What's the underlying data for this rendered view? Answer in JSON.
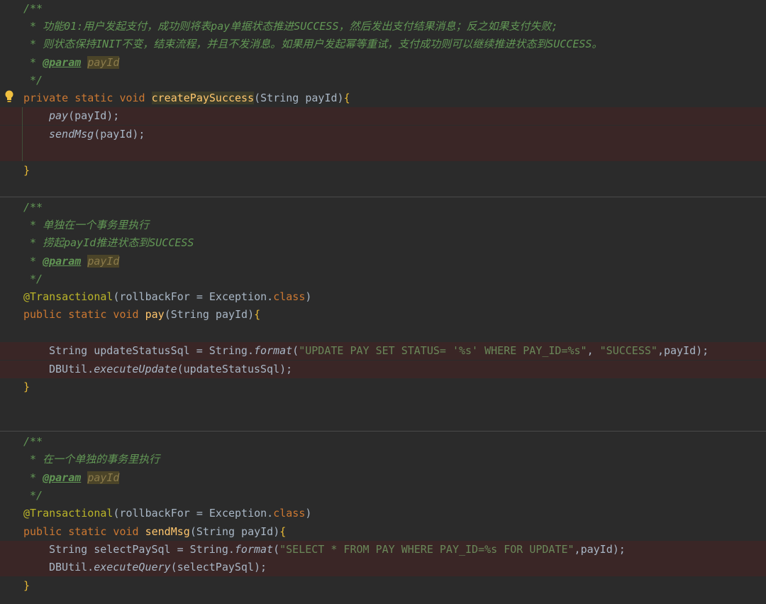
{
  "blocks": [
    {
      "comment": {
        "open": "/**",
        "lines": [
          " * 功能01:用户发起支付，成功则将表pay单据状态推进SUCCESS，然后发出支付结果消息；反之如果支付失败;",
          " * 则状态保持INIT不变，结束流程，并且不发消息。如果用户发起幂等重试，支付成功则可以继续推进状态到SUCCESS。"
        ],
        "param_tag": "@param",
        "param_name": "payId",
        "close": " */"
      },
      "signature": {
        "modifiers": "private static void ",
        "name": "createPaySuccess",
        "params": "(String payId)",
        "brace": "{"
      },
      "body": [
        "pay",
        "(payId);",
        "sendMsg",
        "(payId);"
      ],
      "close": "}"
    },
    {
      "comment": {
        "open": "/**",
        "lines": [
          " * 单独在一个事务里执行",
          " * 捞起payId推进状态到SUCCESS"
        ],
        "param_tag": "@param",
        "param_name": "payId",
        "close": " */"
      },
      "annotation": "@Transactional",
      "annotation_args": "(rollbackFor = Exception.",
      "annotation_kw": "class",
      "annotation_end": ")",
      "signature": {
        "modifiers": "public static void ",
        "name": "pay",
        "params": "(String payId)",
        "brace": "{"
      },
      "stmt1": {
        "a": "String updateStatusSql = String.",
        "m": "format",
        "b": "(",
        "s": "\"UPDATE PAY SET STATUS= '%s' WHERE PAY_ID=%s\"",
        "c": ", ",
        "s2": "\"SUCCESS\"",
        "d": ",payId);"
      },
      "stmt2": {
        "a": "DBUtil.",
        "m": "executeUpdate",
        "b": "(updateStatusSql);"
      },
      "close": "}"
    },
    {
      "comment": {
        "open": "/**",
        "lines": [
          " * 在一个单独的事务里执行"
        ],
        "param_tag": "@param",
        "param_name": "payId",
        "close": " */"
      },
      "annotation": "@Transactional",
      "annotation_args": "(rollbackFor = Exception.",
      "annotation_kw": "class",
      "annotation_end": ")",
      "signature": {
        "modifiers": "public static void ",
        "name": "sendMsg",
        "params": "(String payId)",
        "brace": "{"
      },
      "stmt1": {
        "a": "String selectPaySql = String.",
        "m": "format",
        "b": "(",
        "s": "\"SELECT * FROM PAY WHERE PAY_ID=%s FOR UPDATE\"",
        "d": ",payId);"
      },
      "stmt2": {
        "a": "DBUtil.",
        "m": "executeQuery",
        "b": "(selectPaySql);"
      },
      "close": "}"
    }
  ]
}
